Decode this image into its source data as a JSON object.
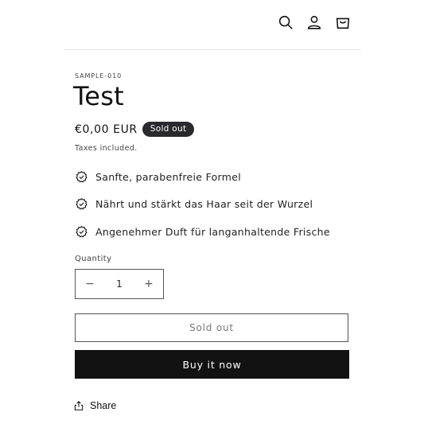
{
  "header": {
    "icons": [
      "search-icon",
      "account-icon",
      "cart-icon"
    ]
  },
  "product": {
    "sku": "SAMPLE-010",
    "title": "Test",
    "price": "€0,00 EUR",
    "badge": "Sold out",
    "taxes_note": "Taxes included."
  },
  "features": [
    {
      "icon": "badge-check-icon",
      "text": "Sanfte, parabenfreie Formel"
    },
    {
      "icon": "badge-check-icon",
      "text": "Nährt und stärkt das Haar seit der Wurzel"
    },
    {
      "icon": "badge-check-icon",
      "text": "Angenehmer Duft für langanhaltende Frische"
    }
  ],
  "quantity": {
    "label": "Quantity",
    "decrease": "−",
    "value": "1",
    "increase": "+"
  },
  "actions": {
    "sold_out_label": "Sold out",
    "buy_now_label": "Buy it now"
  },
  "share": {
    "label": "Share",
    "icon": "share-icon"
  },
  "colors": {
    "text": "#121212",
    "badge_bg": "#2a2a2e",
    "buy_bg": "#121212",
    "border": "#555555"
  }
}
